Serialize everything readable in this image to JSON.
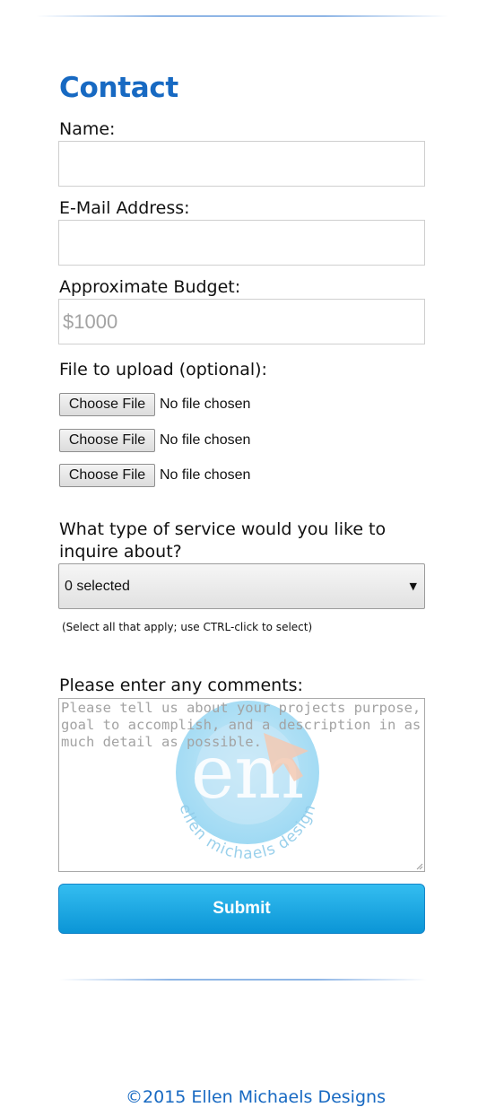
{
  "contact": {
    "heading": "Contact",
    "name_label": "Name:",
    "email_label": "E-Mail Address:",
    "budget_label": "Approximate Budget:",
    "budget_placeholder": "$1000",
    "file_label": "File to upload (optional):",
    "file_inputs": [
      {
        "button_label": "Choose File",
        "status": "No file chosen"
      },
      {
        "button_label": "Choose File",
        "status": "No file chosen"
      },
      {
        "button_label": "Choose File",
        "status": "No file chosen"
      }
    ],
    "service_label": "What type of service would you like to inquire about?",
    "service_selected": "0 selected",
    "service_hint": "(Select all that apply; use CTRL-click to select)",
    "comments_label": "Please enter any comments:",
    "comments_placeholder": "Please tell us about your projects purpose, goal to accomplish, and a description in as much detail as possible.",
    "watermark_text": "ellen michaels design",
    "submit_label": "Submit"
  },
  "footer": {
    "copyright": "©2015 Ellen Michaels Designs"
  },
  "colors": {
    "heading": "#1769c2",
    "submit_top": "#34bdf0",
    "submit_bottom": "#0b95d6"
  },
  "icons": {
    "select_arrow": "dropdown-arrow-icon",
    "watermark": "ellen-michaels-logo-icon"
  }
}
